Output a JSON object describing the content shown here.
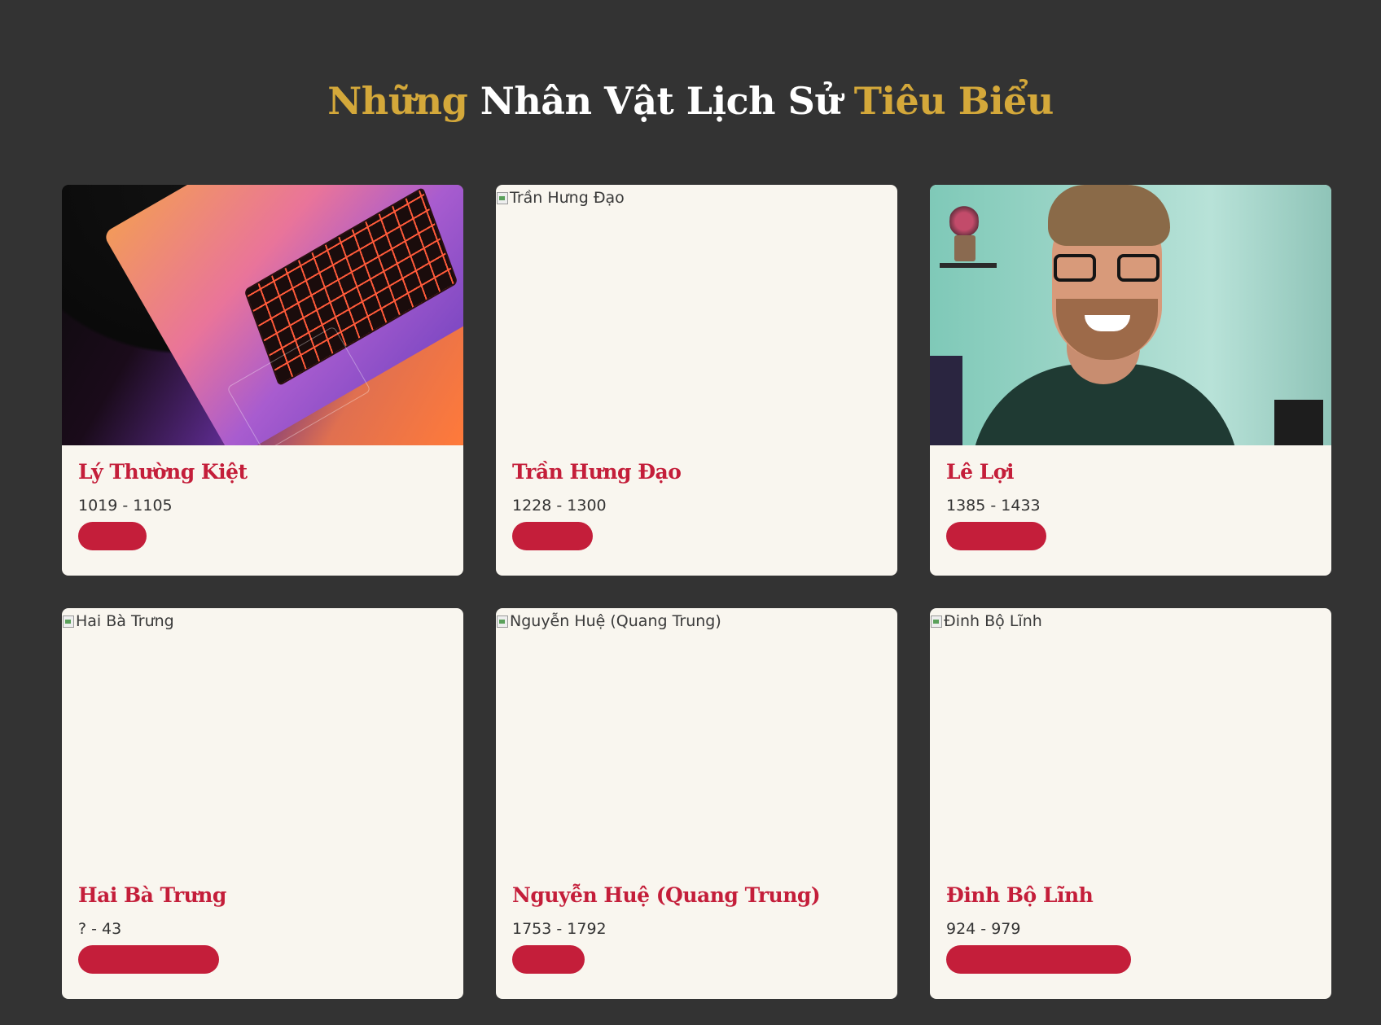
{
  "header": {
    "title_part1": "Những",
    "title_part2": "Nhân Vật Lịch Sử",
    "title_part3": "Tiêu Biểu"
  },
  "colors": {
    "background": "#333333",
    "gold_accent": "#d4a83a",
    "card_background": "#f9f6ef",
    "name_red": "#c41e3a"
  },
  "figures": [
    {
      "name": "Lý Thường Kiệt",
      "years": "1019 - 1105",
      "image_alt": "",
      "image_state": "loaded",
      "image_subject": "laptop-keyboard-photo",
      "badge_fill": 0.17
    },
    {
      "name": "Trần Hưng Đạo",
      "years": "1228 - 1300",
      "image_alt": "Trần Hưng Đạo",
      "image_state": "broken",
      "badge_fill": 0.2
    },
    {
      "name": "Lê Lợi",
      "years": "1385 - 1433",
      "image_alt": "",
      "image_state": "loaded",
      "image_subject": "smiling-man-with-glasses-photo",
      "badge_fill": 0.25
    },
    {
      "name": "Hai Bà Trưng",
      "years": "? - 43",
      "image_alt": "Hai Bà Trưng",
      "image_state": "broken",
      "badge_fill": 0.35
    },
    {
      "name": "Nguyễn Huệ (Quang Trung)",
      "years": "1753 - 1792",
      "image_alt": "Nguyễn Huệ (Quang Trung)",
      "image_state": "broken",
      "badge_fill": 0.18
    },
    {
      "name": "Đinh Bộ Lĩnh",
      "years": "924 - 979",
      "image_alt": "Đinh Bộ Lĩnh",
      "image_state": "broken",
      "badge_fill": 0.46
    }
  ]
}
